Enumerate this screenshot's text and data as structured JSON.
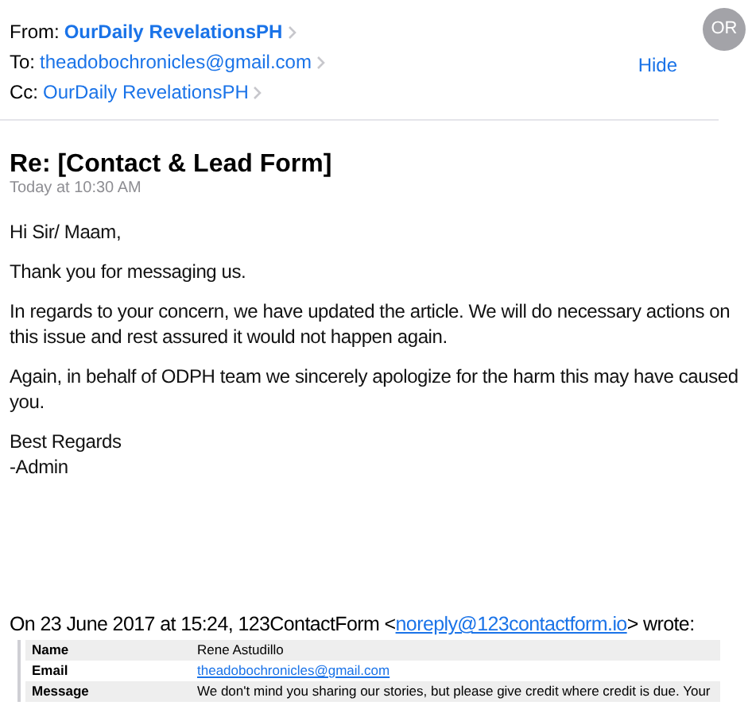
{
  "header": {
    "from": {
      "label": "From:",
      "name": "OurDaily RevelationsPH"
    },
    "to": {
      "label": "To:",
      "address": "theadobochronicles@gmail.com"
    },
    "cc": {
      "label": "Cc:",
      "name": "OurDaily RevelationsPH"
    },
    "hide_link": "Hide",
    "avatar": "OR"
  },
  "subject": "Re: [Contact & Lead Form]",
  "date": "Today at 10:30 AM",
  "body": [
    "Hi Sir/ Maam,",
    "Thank you for messaging us.",
    "In regards to your concern, we have updated the article. We will do necessary actions on this issue and rest assured it would not happen again.",
    "Again, in behalf of ODPH team we sincerely apologize for the harm this may have caused you.",
    "Best Regards\n-Admin"
  ],
  "quote": {
    "intro": "On 23 June 2017 at 15:24, 123ContactForm <",
    "link": "noreply@123contactform.io",
    "outro": "> wrote:",
    "rows": [
      {
        "field": "Name",
        "value": "Rene Astudillo",
        "kind": "text"
      },
      {
        "field": "Email",
        "value": "theadobochronicles@gmail.com",
        "kind": "link"
      },
      {
        "field": "Message",
        "value": "We don't mind you sharing our stories, but please give credit where credit is due. Your",
        "kind": "text"
      }
    ]
  }
}
